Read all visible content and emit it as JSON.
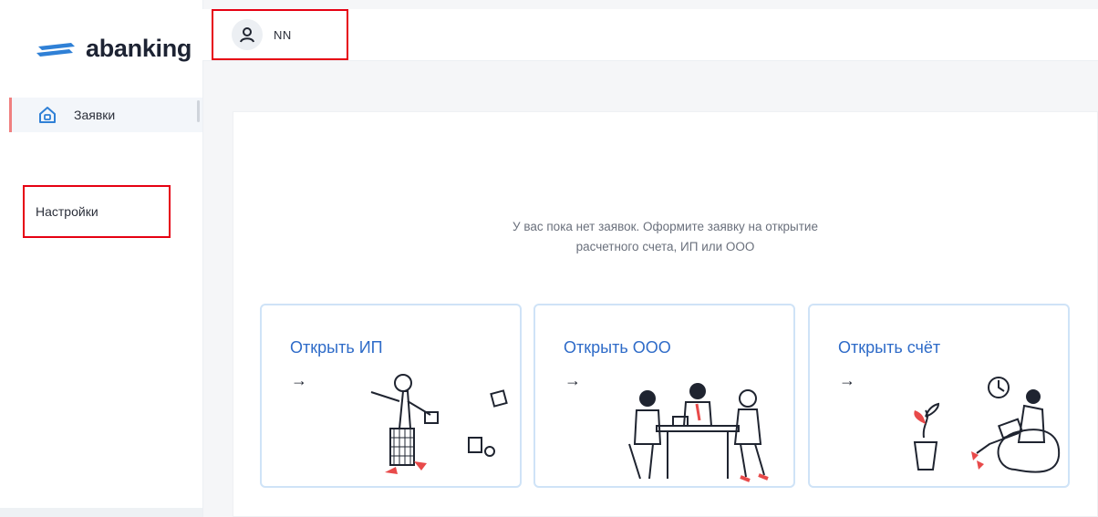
{
  "app": {
    "logo_text": "abanking",
    "brand_color": "#2f80d6",
    "accent_red": "#e60012"
  },
  "user": {
    "name": "NN",
    "icon": "user-icon"
  },
  "sidebar": {
    "items": [
      {
        "label": "Заявки",
        "icon": "home-icon",
        "active": true
      },
      {
        "label": "Настройки",
        "icon": null,
        "active": false
      }
    ]
  },
  "main": {
    "empty_message_line1": "У вас пока нет заявок. Оформите заявку на открытие",
    "empty_message_line2": "расчетного счета, ИП или ООО",
    "cards": [
      {
        "title": "Открыть ИП",
        "arrow": "→",
        "illustration": "walking-person-with-documents"
      },
      {
        "title": "Открыть ООО",
        "arrow": "→",
        "illustration": "team-meeting-at-table"
      },
      {
        "title": "Открыть счёт",
        "arrow": "→",
        "illustration": "person-relaxing-with-plant-and-clock"
      }
    ]
  }
}
